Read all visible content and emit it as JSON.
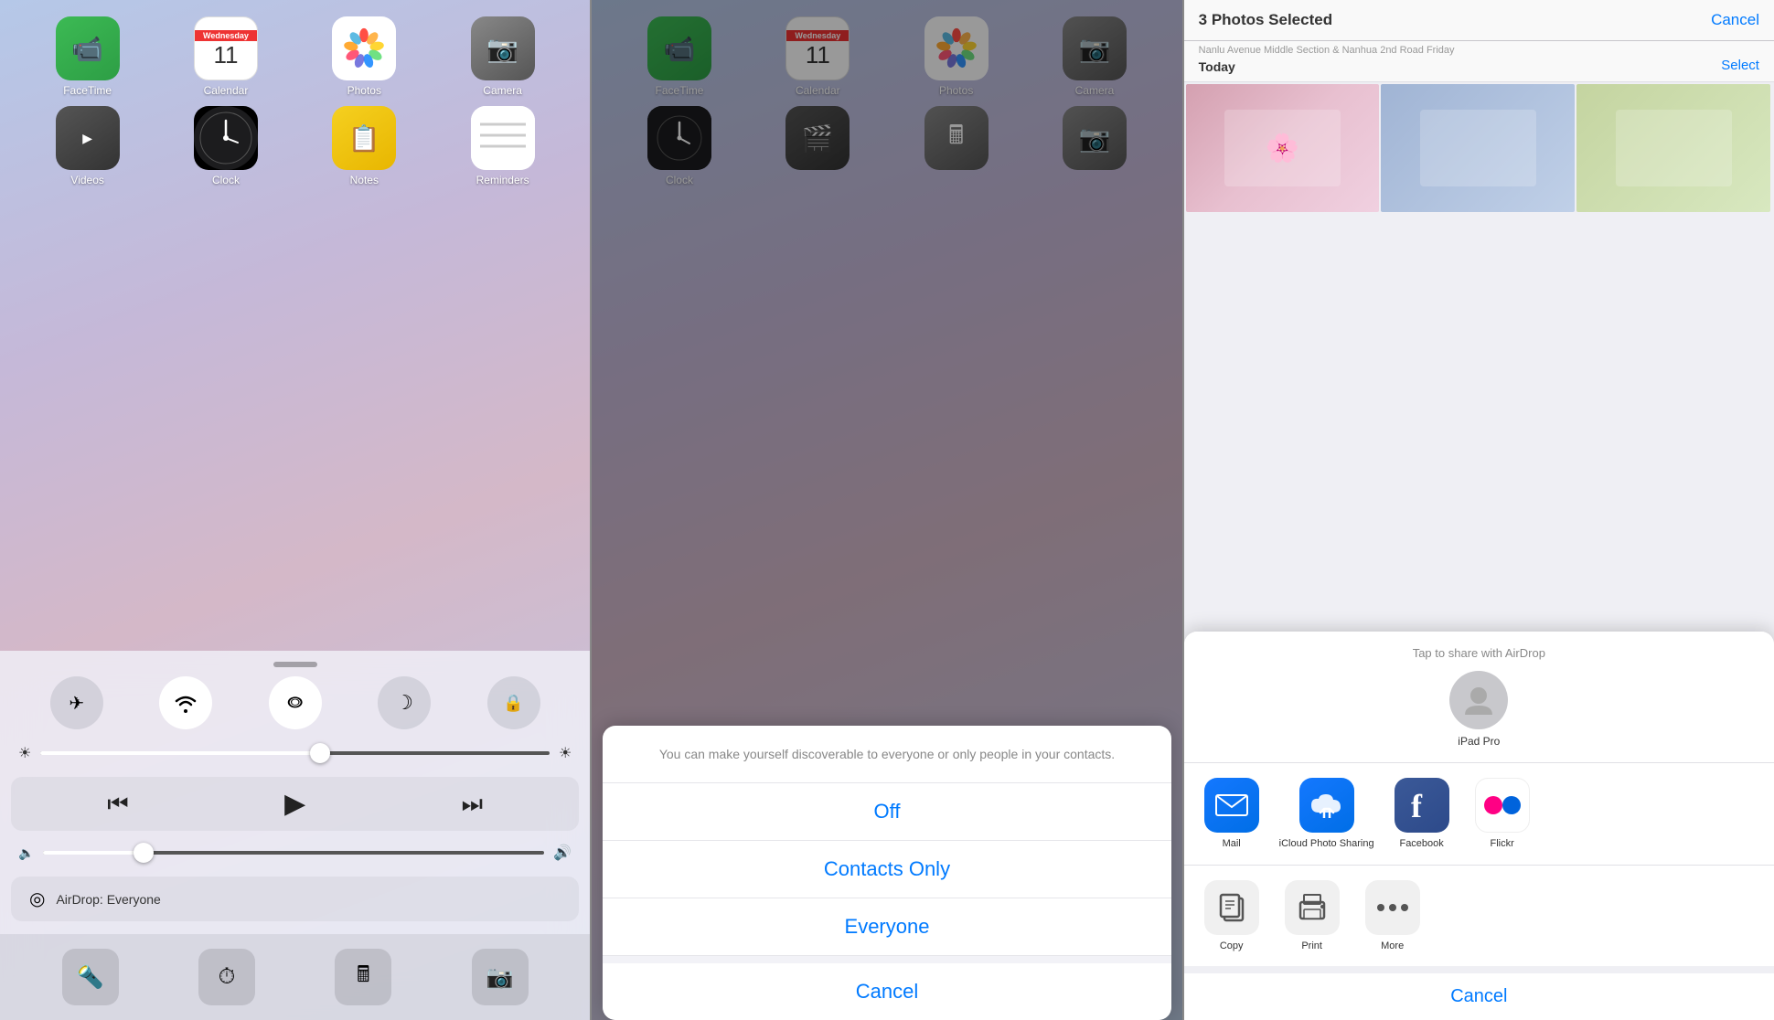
{
  "panel1": {
    "homescreen": {
      "apps_row1": [
        {
          "id": "facetime",
          "label": "FaceTime",
          "emoji": "📹"
        },
        {
          "id": "calendar",
          "label": "Calendar",
          "day_name": "Wednesday",
          "day_num": "11"
        },
        {
          "id": "photos",
          "label": "Photos"
        },
        {
          "id": "camera",
          "label": "Camera",
          "emoji": "📷"
        }
      ],
      "apps_row2": [
        {
          "id": "clock",
          "label": "Clock",
          "emoji": "⏰"
        },
        {
          "id": "reminders",
          "label": "Reminders",
          "emoji": "📋"
        },
        {
          "id": "calculator",
          "label": "Calculator",
          "emoji": "🔢"
        },
        {
          "id": "notes",
          "label": "Notes",
          "emoji": "📝"
        }
      ]
    },
    "control_center": {
      "toggles": [
        {
          "id": "airplane",
          "icon": "✈",
          "active": false,
          "label": "Airplane Mode"
        },
        {
          "id": "wifi",
          "icon": "◉",
          "active": true,
          "label": "Wi-Fi"
        },
        {
          "id": "bluetooth",
          "icon": "⚡",
          "active": true,
          "label": "Bluetooth"
        },
        {
          "id": "donotdisturb",
          "icon": "☽",
          "active": false,
          "label": "Do Not Disturb"
        },
        {
          "id": "rotation",
          "icon": "⊕",
          "active": false,
          "label": "Rotation Lock"
        }
      ],
      "brightness_pct": 55,
      "volume_pct": 20,
      "airdrop_label": "AirDrop: Everyone",
      "quick_apps": [
        {
          "id": "torch",
          "emoji": "🔦"
        },
        {
          "id": "clock2",
          "emoji": "⏱"
        },
        {
          "id": "calc2",
          "emoji": "🖩"
        },
        {
          "id": "cam3",
          "emoji": "📷"
        }
      ]
    }
  },
  "panel2": {
    "airdrop_popup": {
      "description": "You can make yourself discoverable to everyone or only people in your contacts.",
      "options": [
        {
          "id": "off",
          "label": "Off"
        },
        {
          "id": "contacts",
          "label": "Contacts Only"
        },
        {
          "id": "everyone",
          "label": "Everyone"
        }
      ],
      "cancel_label": "Cancel"
    }
  },
  "panel3": {
    "header": {
      "title": "3 Photos Selected",
      "cancel_label": "Cancel",
      "select_label": "Select"
    },
    "sub_header": {
      "location": "Nanlu Avenue Middle Section & Nanhua 2nd Road  Friday",
      "today_label": "Today"
    },
    "share_sheet": {
      "airdrop_label": "Tap to share with AirDrop",
      "device": {
        "name": "iPad Pro"
      },
      "apps": [
        {
          "id": "mail",
          "label": "Mail"
        },
        {
          "id": "icloud",
          "label": "iCloud Photo\nSharing"
        },
        {
          "id": "facebook",
          "label": "Facebook"
        },
        {
          "id": "flickr",
          "label": "Flickr"
        }
      ],
      "actions": [
        {
          "id": "copy",
          "label": "Copy"
        },
        {
          "id": "print",
          "label": "Print"
        },
        {
          "id": "more",
          "label": "More"
        }
      ],
      "cancel_label": "Cancel"
    }
  }
}
